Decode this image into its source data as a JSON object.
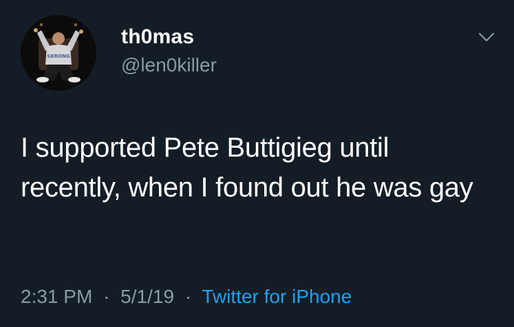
{
  "user": {
    "display_name": "th0mas",
    "handle": "@len0killer",
    "avatar_shirt_text": "SKRONG"
  },
  "tweet": {
    "text": "I supported Pete Buttigieg until recently, when I found out he was gay",
    "time": "2:31 PM",
    "date": "5/1/19",
    "separator": "·",
    "source": "Twitter for iPhone"
  },
  "icons": {
    "menu": "chevron-down-icon"
  },
  "colors": {
    "background": "#141d26",
    "text": "#ffffff",
    "secondary_text": "#8899a6",
    "link": "#1da1f2"
  }
}
